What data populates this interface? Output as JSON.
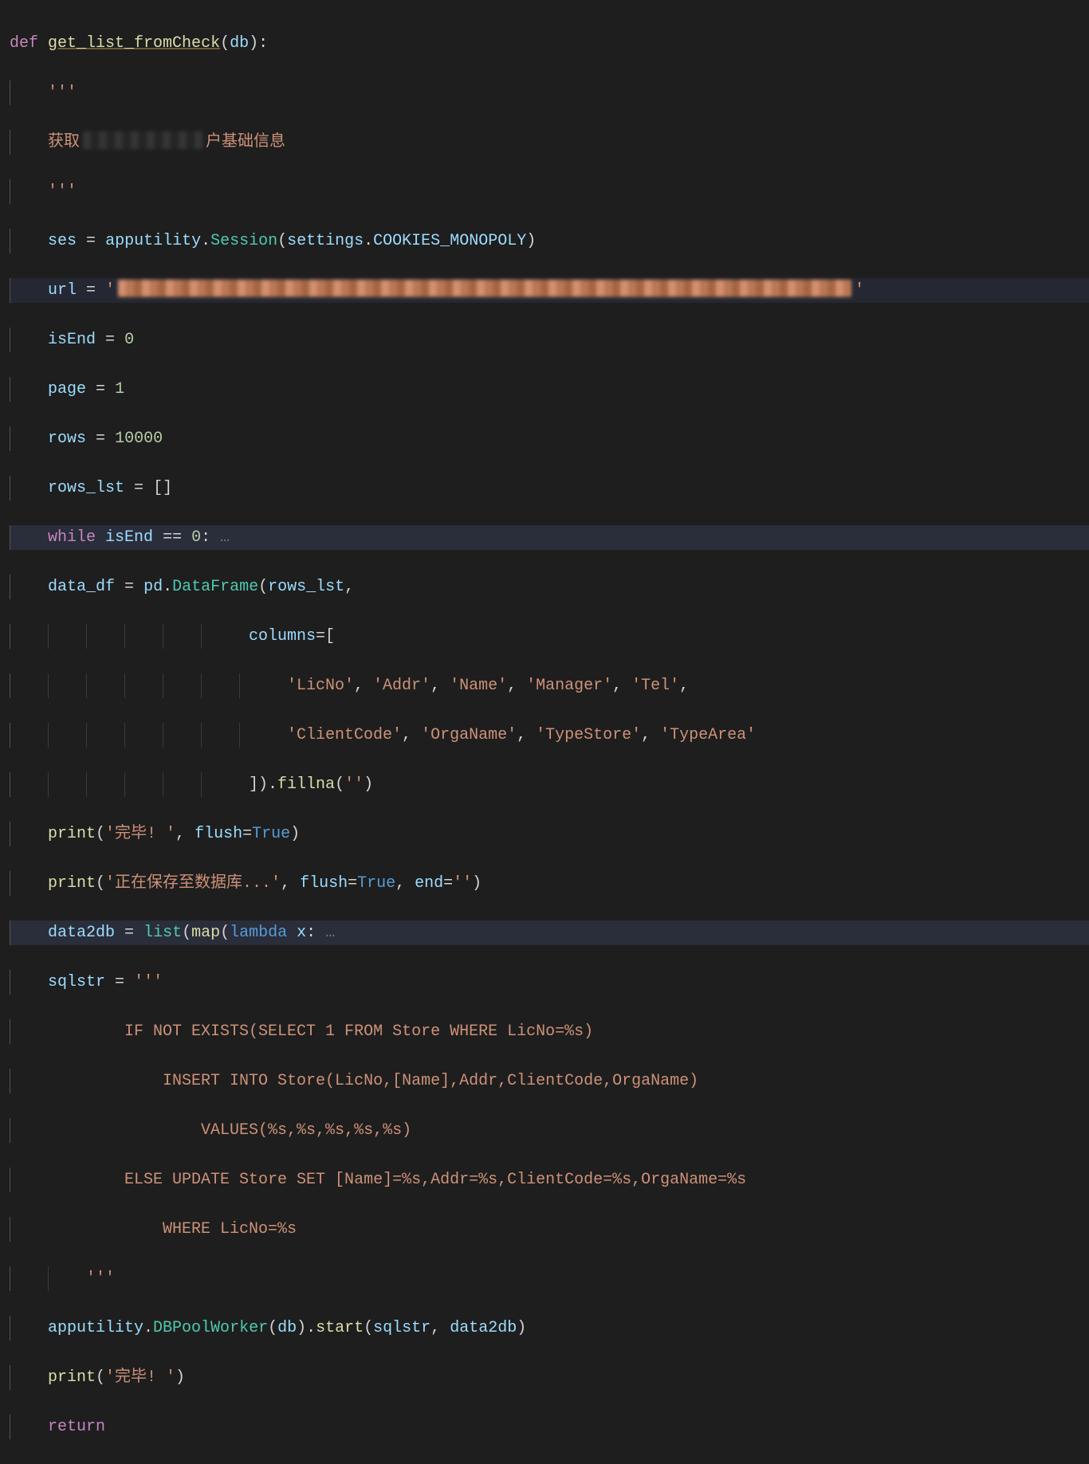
{
  "tokens": {
    "def": "def",
    "fn_name": "get_list_fromCheck",
    "param_db": "db",
    "docopen": "'''",
    "doc_prefix": "获取",
    "doc_suffix": "户基础信息",
    "docclose": "'''",
    "ses": "ses",
    "apputility": "apputility",
    "Session": "Session",
    "settings": "settings",
    "COOKIES_MONOPOLY": "COOKIES_MONOPOLY",
    "url": "url",
    "isEnd": "isEnd",
    "page": "page",
    "rows": "rows",
    "rows_lst": "rows_lst",
    "zero": "0",
    "one": "1",
    "tenk": "10000",
    "empty_list": "[]",
    "while": "while",
    "eqeq": "==",
    "colon": ":",
    "dots": "…",
    "data_df": "data_df",
    "pd": "pd",
    "DataFrame": "DataFrame",
    "columns": "columns",
    "eq": "=",
    "lbrack": "[",
    "rbrack": "]",
    "col_LicNo": "'LicNo'",
    "col_Addr": "'Addr'",
    "col_Name": "'Name'",
    "col_Manager": "'Manager'",
    "col_Tel": "'Tel'",
    "col_ClientCode": "'ClientCode'",
    "col_OrgaName": "'OrgaName'",
    "col_TypeStore": "'TypeStore'",
    "col_TypeArea": "'TypeArea'",
    "fillna": "fillna",
    "empty_str": "''",
    "print": "print",
    "done": "'完毕! '",
    "flush": "flush",
    "true": "True",
    "saving": "'正在保存至数据库...'",
    "end": "end",
    "data2db": "data2db",
    "list": "list",
    "map": "map",
    "lambda": "lambda",
    "x": "x",
    "sqlstr": "sqlstr",
    "sql1": "        IF NOT EXISTS(SELECT 1 FROM Store WHERE LicNo=%s)",
    "sql2": "            INSERT INTO Store(LicNo,[Name],Addr,ClientCode,OrgaName)",
    "sql3": "                VALUES(%s,%s,%s,%s,%s)",
    "sql4": "        ELSE UPDATE Store SET [Name]=%s,Addr=%s,ClientCode=%s,OrgaName=%s",
    "sql5": "            WHERE LicNo=%s",
    "DBPoolWorker": "DBPoolWorker",
    "start": "start",
    "return": "return"
  }
}
